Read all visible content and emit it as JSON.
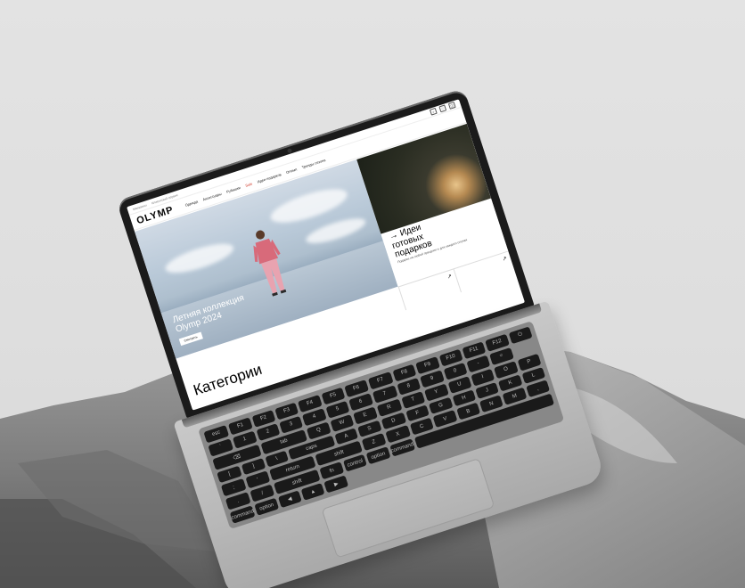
{
  "site": {
    "logo": "OLYMP",
    "utility_links": [
      "Магазины",
      "Клиентский сервис"
    ],
    "header_icons": [
      "search-icon",
      "heart-icon",
      "bag-icon"
    ],
    "nav": [
      "Одежда",
      "Аксессуары",
      "Рубашки",
      "Sale",
      "Идеи подарков",
      "Олимп",
      "Тренды сезона"
    ]
  },
  "hero": {
    "title_line1": "Летняя коллекция",
    "title_line2": "Olymp 2024",
    "button": "Смотреть"
  },
  "side": {
    "arrow": "→",
    "title_line1": "Идеи",
    "title_line2": "готовых",
    "title_line3": "подарков",
    "subtitle": "Подарки на любой праздник и для каждого случая"
  },
  "promo": {
    "arrow1": "↗",
    "arrow2": "↗"
  },
  "categories": {
    "title": "Категории"
  },
  "keyboard": {
    "rows": [
      [
        "esc",
        "F1",
        "F2",
        "F3",
        "F4",
        "F5",
        "F6",
        "F7",
        "F8",
        "F9",
        "F10",
        "F11",
        "F12",
        "⏻"
      ],
      [
        "`",
        "1",
        "2",
        "3",
        "4",
        "5",
        "6",
        "7",
        "8",
        "9",
        "0",
        "-",
        "=",
        "⌫"
      ],
      [
        "tab",
        "Q",
        "W",
        "E",
        "R",
        "T",
        "Y",
        "U",
        "I",
        "O",
        "P",
        "[",
        "]",
        "\\"
      ],
      [
        "caps",
        "A",
        "S",
        "D",
        "F",
        "G",
        "H",
        "J",
        "K",
        "L",
        ";",
        "'",
        "return"
      ],
      [
        "shift",
        "Z",
        "X",
        "C",
        "V",
        "B",
        "N",
        "M",
        ",",
        ".",
        "/",
        "shift"
      ],
      [
        "fn",
        "control",
        "option",
        "command",
        "",
        "command",
        "option",
        "◀",
        "▲",
        "▶"
      ]
    ]
  },
  "colors": {
    "sale": "#d03a2b",
    "bezel": "#1b1b1b",
    "aluminium": "#bdbdbd"
  }
}
